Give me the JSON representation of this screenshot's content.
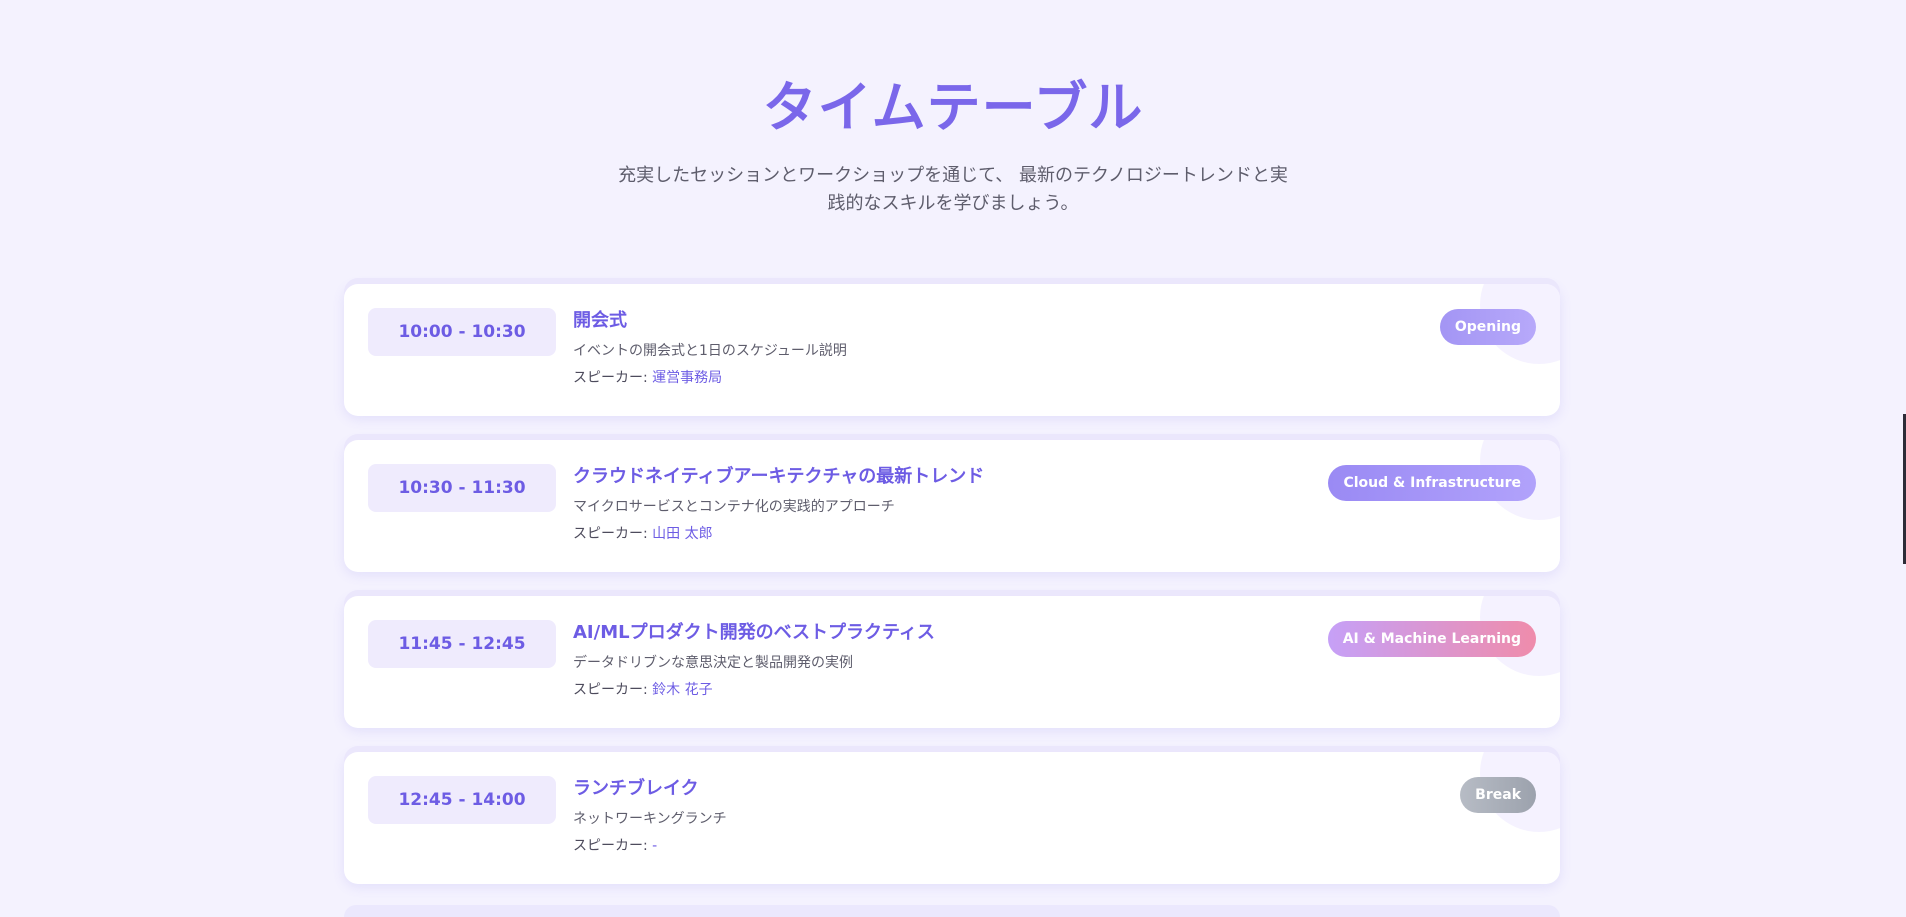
{
  "page": {
    "title": "タイムテーブル",
    "subtitle_line1": "充実したセッションとワークショップを通じて、 最新のテクノロジートレンドと実",
    "subtitle_line2": "践的なスキルを学びましょう。"
  },
  "colors": {
    "background": "#f4f2fe",
    "accent": "#7a67ea",
    "time_box_background": "#efebfd",
    "card_background": "#ffffff"
  },
  "speaker_label": "スピーカー: ",
  "sessions": [
    {
      "time": "10:00 - 10:30",
      "title": "開会式",
      "description": "イベントの開会式と1日のスケジュール説明",
      "speaker": "運営事務局",
      "category": "Opening"
    },
    {
      "time": "10:30 - 11:30",
      "title": "クラウドネイティブアーキテクチャの最新トレンド",
      "description": "マイクロサービスとコンテナ化の実践的アプローチ",
      "speaker": "山田 太郎",
      "category": "Cloud & Infrastructure"
    },
    {
      "time": "11:45 - 12:45",
      "title": "AI/MLプロダクト開発のベストプラクティス",
      "description": "データドリブンな意思決定と製品開発の実例",
      "speaker": "鈴木 花子",
      "category": "AI & Machine Learning"
    },
    {
      "time": "12:45 - 14:00",
      "title": "ランチブレイク",
      "description": "ネットワーキングランチ",
      "speaker": "-",
      "category": "Break"
    }
  ]
}
